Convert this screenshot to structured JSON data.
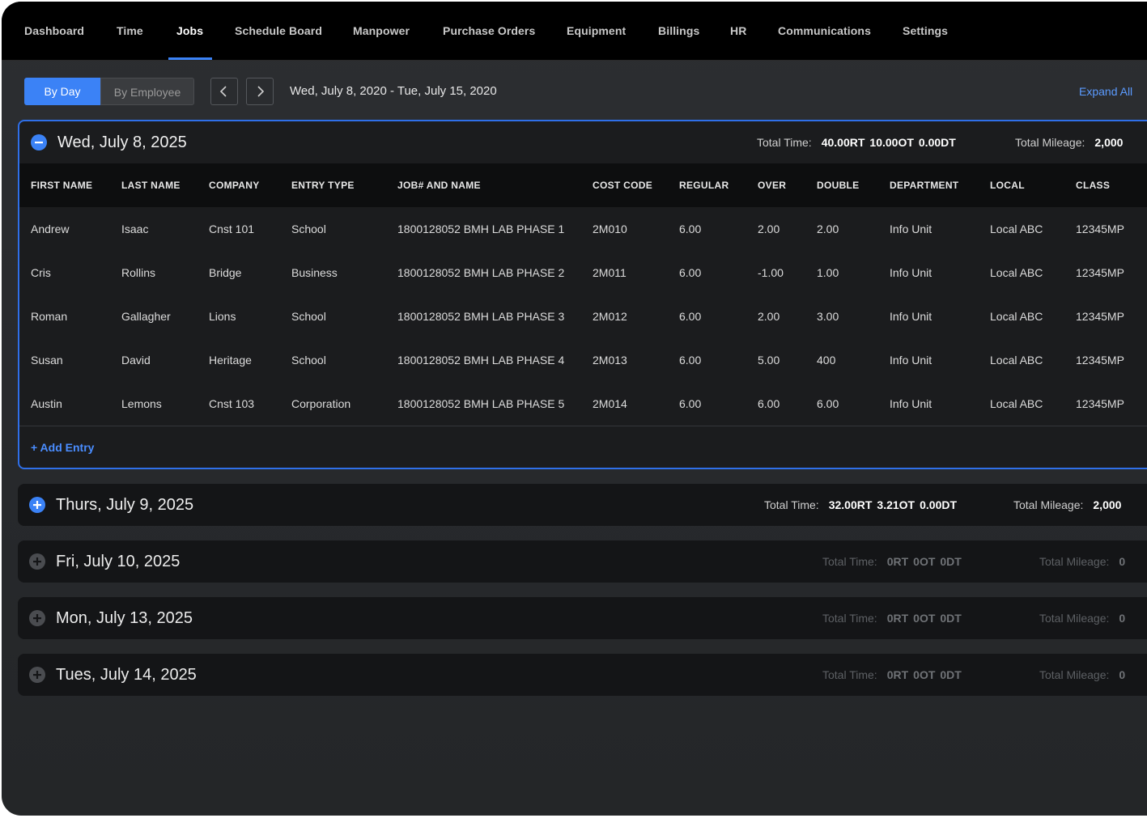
{
  "nav": {
    "items": [
      {
        "label": "Dashboard"
      },
      {
        "label": "Time"
      },
      {
        "label": "Jobs"
      },
      {
        "label": "Schedule Board"
      },
      {
        "label": "Manpower"
      },
      {
        "label": "Purchase Orders"
      },
      {
        "label": "Equipment"
      },
      {
        "label": "Billings"
      },
      {
        "label": "HR"
      },
      {
        "label": "Communications"
      },
      {
        "label": "Settings"
      }
    ],
    "active": "Jobs"
  },
  "toolbar": {
    "view_toggle": {
      "by_day": "By Day",
      "by_employee": "By Employee",
      "selected": "By Day"
    },
    "prev_icon": "chevron-left-icon",
    "next_icon": "chevron-right-icon",
    "date_range": "Wed, July 8, 2020 - Tue, July 15, 2020",
    "expand_all": "Expand All"
  },
  "days": [
    {
      "title": "Wed, July 8, 2025",
      "expanded": true,
      "total_time_label": "Total Time:",
      "rt": "40.00RT",
      "ot": "10.00OT",
      "dt": "0.00DT",
      "mileage_label": "Total Mileage:",
      "mileage": "2,000",
      "columns": [
        "FIRST NAME",
        "LAST NAME",
        "COMPANY",
        "ENTRY TYPE",
        "JOB# AND NAME",
        "COST CODE",
        "REGULAR",
        "OVER",
        "DOUBLE",
        "DEPARTMENT",
        "LOCAL",
        "CLASS"
      ],
      "rows": [
        [
          "Andrew",
          "Isaac",
          "Cnst 101",
          "School",
          "1800128052 BMH LAB PHASE 1",
          "2M010",
          "6.00",
          "2.00",
          "2.00",
          "Info Unit",
          "Local ABC",
          "12345MP"
        ],
        [
          "Cris",
          "Rollins",
          "Bridge",
          "Business",
          "1800128052 BMH LAB PHASE 2",
          "2M011",
          "6.00",
          "-1.00",
          "1.00",
          "Info Unit",
          "Local ABC",
          "12345MP"
        ],
        [
          "Roman",
          "Gallagher",
          "Lions",
          "School",
          "1800128052 BMH LAB PHASE 3",
          "2M012",
          "6.00",
          "2.00",
          "3.00",
          "Info Unit",
          "Local ABC",
          "12345MP"
        ],
        [
          "Susan",
          "David",
          "Heritage",
          "School",
          "1800128052 BMH LAB PHASE 4",
          "2M013",
          "6.00",
          "5.00",
          "400",
          "Info Unit",
          "Local ABC",
          "12345MP"
        ],
        [
          "Austin",
          "Lemons",
          "Cnst 103",
          "Corporation",
          "1800128052 BMH LAB PHASE 5",
          "2M014",
          "6.00",
          "6.00",
          "6.00",
          "Info Unit",
          "Local ABC",
          "12345MP"
        ]
      ],
      "add_entry": "+ Add Entry"
    },
    {
      "title": "Thurs, July 9, 2025",
      "expanded": false,
      "total_time_label": "Total Time:",
      "rt": "32.00RT",
      "ot": "3.21OT",
      "dt": "0.00DT",
      "mileage_label": "Total Mileage:",
      "mileage": "2,000"
    },
    {
      "title": "Fri, July 10, 2025",
      "expanded": false,
      "total_time_label": "Total Time:",
      "rt": "0RT",
      "ot": "0OT",
      "dt": "0DT",
      "mileage_label": "Total Mileage:",
      "mileage": "0"
    },
    {
      "title": "Mon, July 13, 2025",
      "expanded": false,
      "total_time_label": "Total Time:",
      "rt": "0RT",
      "ot": "0OT",
      "dt": "0DT",
      "mileage_label": "Total Mileage:",
      "mileage": "0"
    },
    {
      "title": "Tues, July 14, 2025",
      "expanded": false,
      "total_time_label": "Total Time:",
      "rt": "0RT",
      "ot": "0OT",
      "dt": "0DT",
      "mileage_label": "Total Mileage:",
      "mileage": "0"
    }
  ],
  "colors": {
    "accent": "#3b82f6",
    "nav_bg": "#000000",
    "panel_bg": "#1b1c1e",
    "link": "#4a8dff"
  }
}
